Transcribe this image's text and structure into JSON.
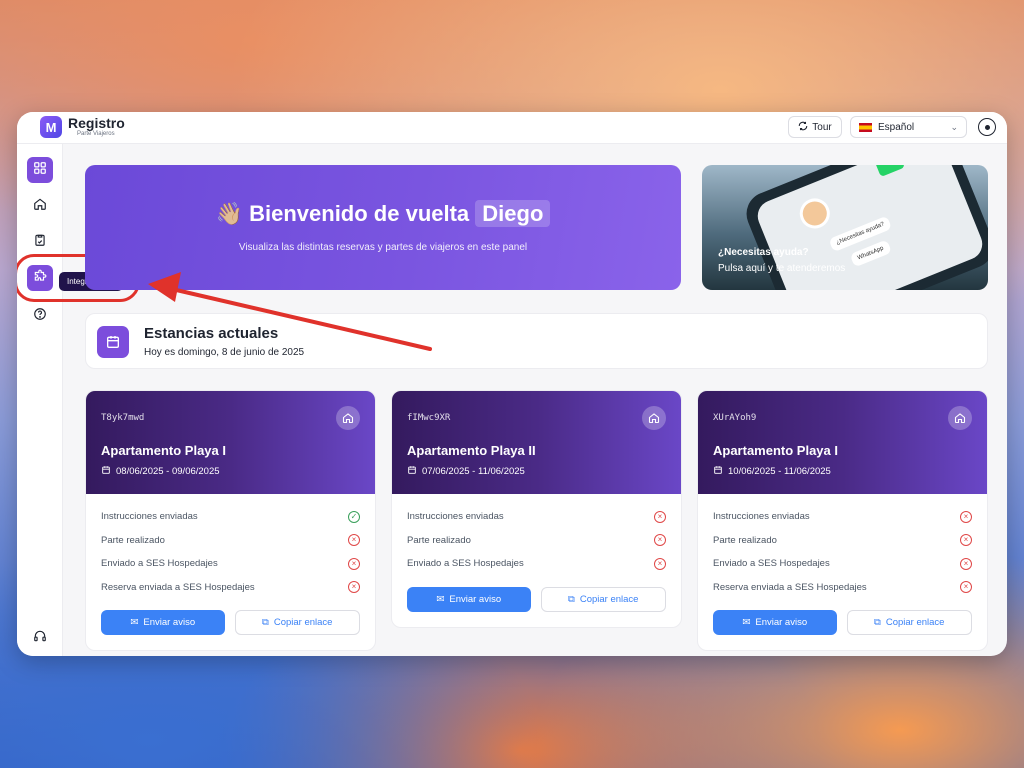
{
  "app": {
    "brand": "Registro",
    "brand_sub": "Parte Viajeros",
    "logo_letter": "M"
  },
  "topbar": {
    "tour_label": "Tour",
    "language": "Español"
  },
  "sidebar": {
    "items": [
      {
        "name": "dashboard",
        "icon": "grid-icon",
        "active": true
      },
      {
        "name": "home",
        "icon": "home-icon",
        "active": false
      },
      {
        "name": "documents",
        "icon": "clipboard-icon",
        "active": false
      },
      {
        "name": "integraciones",
        "icon": "puzzle-icon",
        "active": true
      },
      {
        "name": "help",
        "icon": "help-circle-icon",
        "active": false
      }
    ],
    "support_icon": "headset-icon",
    "tooltip": "Integraciones"
  },
  "hero": {
    "emoji": "👋🏼",
    "greeting": "Bienvenido de vuelta",
    "name": "Diego",
    "subtitle": "Visualiza las distintas reservas y partes de viajeros en este panel"
  },
  "help_card": {
    "title": "¿Necesitas ayuda?",
    "subtitle": "Pulsa aquí y te atenderemos",
    "bubble_text": "¿Necesitas ayuda?",
    "whatsapp_label": "WhatsApp"
  },
  "stays": {
    "title": "Estancias actuales",
    "subtitle": "Hoy es domingo, 8 de junio de 2025"
  },
  "cards": [
    {
      "code": "T8yk7mwd",
      "name": "Apartamento Playa I",
      "dates": "08/06/2025 - 09/06/2025",
      "statuses": [
        {
          "label": "Instrucciones enviadas",
          "ok": true
        },
        {
          "label": "Parte realizado",
          "ok": false
        },
        {
          "label": "Enviado a SES Hospedajes",
          "ok": false
        },
        {
          "label": "Reserva enviada a SES Hospedajes",
          "ok": false
        }
      ],
      "send_label": "Enviar aviso",
      "copy_label": "Copiar enlace"
    },
    {
      "code": "fIMwc9XR",
      "name": "Apartamento Playa II",
      "dates": "07/06/2025 - 11/06/2025",
      "statuses": [
        {
          "label": "Instrucciones enviadas",
          "ok": false
        },
        {
          "label": "Parte realizado",
          "ok": false
        },
        {
          "label": "Enviado a SES Hospedajes",
          "ok": false
        }
      ],
      "send_label": "Enviar aviso",
      "copy_label": "Copiar enlace"
    },
    {
      "code": "XUrAYoh9",
      "name": "Apartamento Playa I",
      "dates": "10/06/2025 - 11/06/2025",
      "statuses": [
        {
          "label": "Instrucciones enviadas",
          "ok": false
        },
        {
          "label": "Parte realizado",
          "ok": false
        },
        {
          "label": "Enviado a SES Hospedajes",
          "ok": false
        },
        {
          "label": "Reserva enviada a SES Hospedajes",
          "ok": false
        }
      ],
      "send_label": "Enviar aviso",
      "copy_label": "Copiar enlace"
    }
  ],
  "colors": {
    "accent": "#7c4ddc",
    "button_blue": "#3b82f6",
    "error": "#e04848",
    "success": "#3aa05b",
    "annotation_red": "#e0322b"
  }
}
